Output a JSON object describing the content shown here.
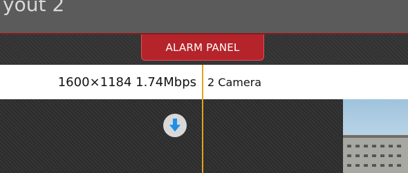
{
  "window": {
    "title": "yout 2"
  },
  "alarm_panel": {
    "label": "ALARM PANEL"
  },
  "cameras": [
    {
      "stats": "1600×1184 1.74Mbps"
    },
    {
      "name": "2 Camera"
    }
  ],
  "icons": {
    "download": "download-icon"
  },
  "colors": {
    "alarm_tab": "#b5242a",
    "divider": "#e6a21a",
    "download_arrow": "#1e90e8"
  }
}
